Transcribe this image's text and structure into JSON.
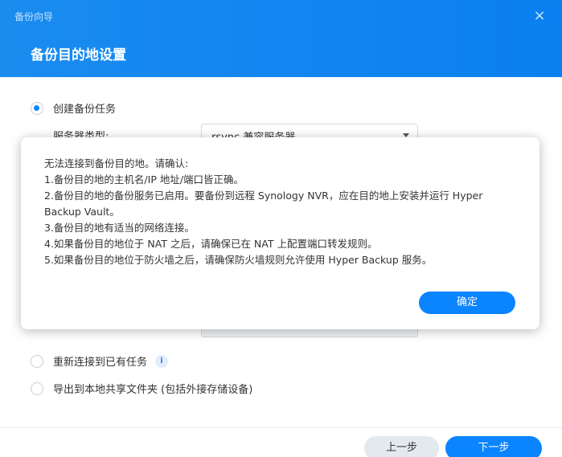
{
  "window": {
    "title": "备份向导",
    "close_glyph": "×"
  },
  "header": {
    "step_title": "备份目的地设置"
  },
  "options": {
    "create_task": "创建备份任务",
    "reconnect_task": "重新连接到已有任务",
    "export_local": "导出到本地共享文件夹 (包括外接存储设备)",
    "info_glyph": "i"
  },
  "form": {
    "server_type_label": "服务器类型:",
    "server_type_value": "rsync 兼容服务器"
  },
  "dialog": {
    "lines": [
      "无法连接到备份目的地。请确认:",
      "1.备份目的地的主机名/IP 地址/端口皆正确。",
      "2.备份目的地的备份服务已启用。要备份到远程 Synology NVR，应在目的地上安装并运行 Hyper Backup Vault。",
      "3.备份目的地有适当的网络连接。",
      "4.如果备份目的地位于 NAT 之后，请确保已在 NAT 上配置端口转发规则。",
      "5.如果备份目的地位于防火墙之后，请确保防火墙规则允许使用 Hyper Backup 服务。"
    ],
    "ok_label": "确定"
  },
  "footer": {
    "prev_label": "上一步",
    "next_label": "下一步"
  },
  "colors": {
    "header_blue": "#0a84ff",
    "primary_button": "#0a84ff",
    "secondary_button": "#e4e9f0"
  }
}
